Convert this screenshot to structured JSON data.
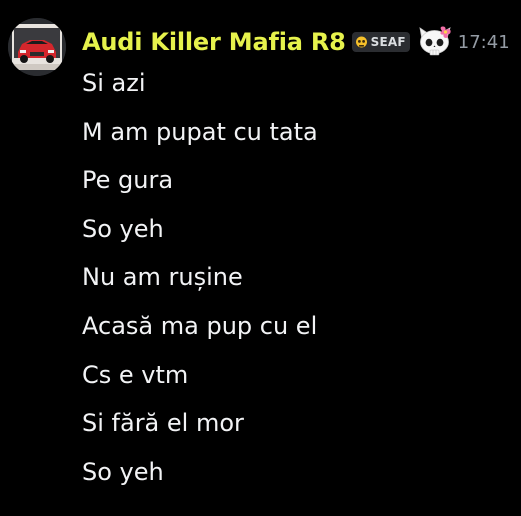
{
  "author": {
    "name": "Audi Killer Mafia R8",
    "avatar_icon": "red-car-avatar-icon",
    "name_color": "#e6f24c"
  },
  "clan_tag": {
    "icon": "skull-emoji-icon",
    "text": "SEAF"
  },
  "decoration_icon": "hello-kitty-skull-icon",
  "timestamp": "17:41",
  "messages": [
    {
      "text": "Si azi"
    },
    {
      "text": "M am pupat cu tata"
    },
    {
      "text": "Pe gura"
    },
    {
      "text": "So yeh"
    },
    {
      "text": "Nu am rușine"
    },
    {
      "text": "Acasă ma pup cu el"
    },
    {
      "text": "Cs e vtm"
    },
    {
      "text": "Si fără el mor"
    },
    {
      "text": "So yeh"
    }
  ]
}
